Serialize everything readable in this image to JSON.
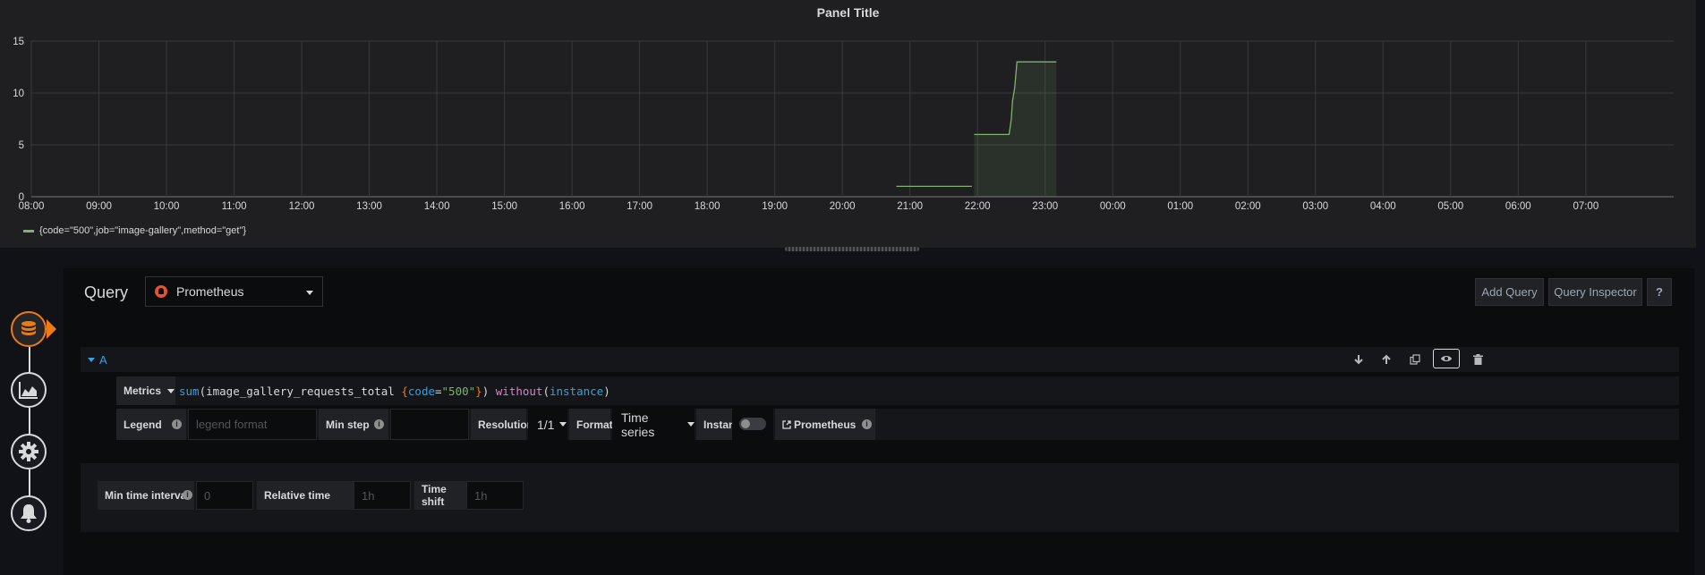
{
  "panel": {
    "title": "Panel Title"
  },
  "chart_data": {
    "type": "line",
    "title": "Panel Title",
    "x_ticks": [
      "08:00",
      "09:00",
      "10:00",
      "11:00",
      "12:00",
      "13:00",
      "14:00",
      "15:00",
      "16:00",
      "17:00",
      "18:00",
      "19:00",
      "20:00",
      "21:00",
      "22:00",
      "23:00",
      "00:00",
      "01:00",
      "02:00",
      "03:00",
      "04:00",
      "05:00",
      "06:00",
      "07:00"
    ],
    "ylim": [
      0,
      15
    ],
    "y_ticks": [
      0,
      5,
      10,
      15
    ],
    "grid": true,
    "series": [
      {
        "name": "{code=\"500\",job=\"image-gallery\",method=\"get\"}",
        "color": "#7eb26d",
        "fill_from": "21:57",
        "points": [
          [
            "20:48",
            1
          ],
          [
            "21:55",
            1
          ],
          [
            "21:57",
            6
          ],
          [
            "22:28",
            6
          ],
          [
            "22:30",
            7.5
          ],
          [
            "22:31",
            9.2
          ],
          [
            "22:33",
            10.5
          ],
          [
            "22:35",
            13
          ],
          [
            "23:10",
            13
          ]
        ]
      }
    ]
  },
  "legend": {
    "label": "{code=\"500\",job=\"image-gallery\",method=\"get\"}"
  },
  "rail": {
    "icons": [
      "database-icon",
      "chart-icon",
      "gear-icon",
      "bell-icon"
    ]
  },
  "query": {
    "label": "Query",
    "datasource": "Prometheus",
    "add_query_label": "Add Query",
    "inspector_label": "Query Inspector",
    "help_label": "?"
  },
  "row": {
    "letter": "A"
  },
  "metrics": {
    "label": "Metrics",
    "expr_tokens": [
      {
        "t": "sum",
        "c": "tok-fn"
      },
      {
        "t": "(image_gallery_requests_total ",
        "c": "tok-plain"
      },
      {
        "t": "{",
        "c": "tok-brace"
      },
      {
        "t": "code",
        "c": "tok-label"
      },
      {
        "t": "=",
        "c": "tok-plain"
      },
      {
        "t": "\"500\"",
        "c": "tok-str"
      },
      {
        "t": "}",
        "c": "tok-brace"
      },
      {
        "t": ") ",
        "c": "tok-plain"
      },
      {
        "t": "without",
        "c": "tok-kw"
      },
      {
        "t": "(",
        "c": "tok-plain"
      },
      {
        "t": "instance",
        "c": "tok-fn"
      },
      {
        "t": ")",
        "c": "tok-plain"
      }
    ]
  },
  "options": {
    "legend_label": "Legend",
    "legend_placeholder": "legend format",
    "min_step_label": "Min step",
    "resolution_label": "Resolution",
    "resolution_value": "1/1",
    "format_label": "Format",
    "format_value": "Time series",
    "instant_label": "Instant",
    "prom_link": "Prometheus"
  },
  "query_options": {
    "min_interval_label": "Min time interval",
    "min_interval_placeholder": "0",
    "relative_label": "Relative time",
    "relative_placeholder": "1h",
    "shift_label": "Time shift",
    "shift_placeholder": "1h"
  }
}
